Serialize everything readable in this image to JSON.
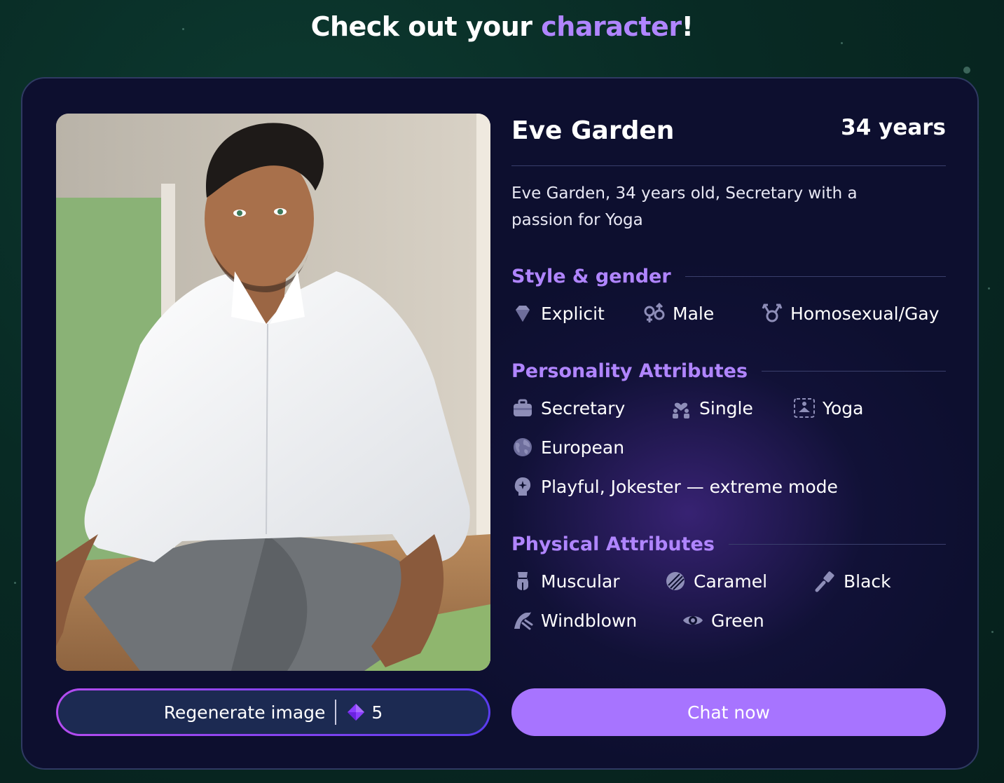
{
  "page": {
    "heading_prefix": "Check out your ",
    "heading_accent": "character",
    "heading_suffix": "!"
  },
  "character": {
    "name": "Eve Garden",
    "age": "34 years",
    "description": "Eve Garden, 34 years old, Secretary with a passion for Yoga"
  },
  "sections": {
    "style": {
      "title": "Style & gender",
      "tags": [
        {
          "label": "Explicit",
          "icon": "diamond-icon"
        },
        {
          "label": "Male",
          "icon": "gender-symbol-icon"
        },
        {
          "label": "Homosexual/Gay",
          "icon": "orientation-symbol-icon"
        }
      ]
    },
    "personality": {
      "title": "Personality Attributes",
      "tags": [
        {
          "label": "Secretary",
          "icon": "briefcase-icon"
        },
        {
          "label": "Single",
          "icon": "person-heart-icon"
        },
        {
          "label": "Yoga",
          "icon": "yoga-icon"
        },
        {
          "label": "European",
          "icon": "globe-icon"
        },
        {
          "label": "Playful, Jokester — extreme mode",
          "icon": "sparkle-head-icon"
        }
      ]
    },
    "physical": {
      "title": "Physical Attributes",
      "tags": [
        {
          "label": "Muscular",
          "icon": "body-icon"
        },
        {
          "label": "Caramel",
          "icon": "skin-tone-icon"
        },
        {
          "label": "Black",
          "icon": "hair-brush-icon"
        },
        {
          "label": "Windblown",
          "icon": "hair-style-icon"
        },
        {
          "label": "Green",
          "icon": "eye-icon"
        }
      ]
    }
  },
  "buttons": {
    "regenerate_label": "Regenerate image",
    "regenerate_cost": "5",
    "chat_label": "Chat now"
  },
  "colors": {
    "accent": "#b085ff",
    "card_bg": "#0d0f2f",
    "chat_button": "#a774ff"
  }
}
